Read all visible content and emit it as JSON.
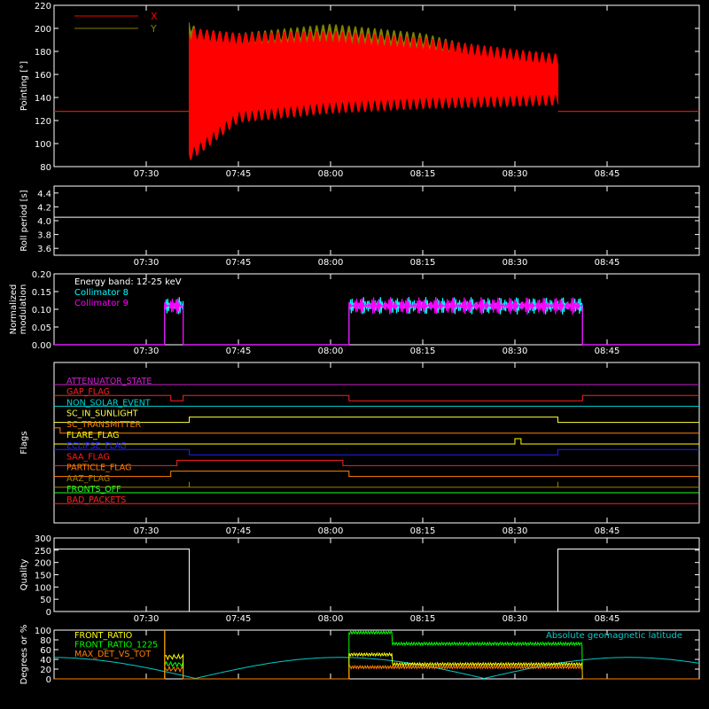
{
  "colors": {
    "background": "#000000",
    "axis": "#ffffff",
    "x_pointing": "#ff0000",
    "y_pointing": "#808000",
    "collimator8": "#00ffff",
    "collimator9": "#ff00ff",
    "geomag": "#00cccc",
    "front_ratio": "#ffff00",
    "front_ratio_1225": "#00ff00",
    "max_det": "#ff8000"
  },
  "time_axis": {
    "start": "07:15",
    "end": "09:00",
    "ticks": [
      "07:30",
      "07:45",
      "08:00",
      "08:15",
      "08:30",
      "08:45"
    ]
  },
  "chart_data": [
    {
      "id": "pointing",
      "type": "line",
      "ylabel": "Pointing [°]",
      "ylim": [
        80,
        220
      ],
      "yticks": [
        "80",
        "100",
        "120",
        "140",
        "160",
        "180",
        "200",
        "220"
      ],
      "legend": [
        "X",
        "Y"
      ],
      "series": [
        {
          "name": "X",
          "color": "#ff0000",
          "baseline": 128,
          "active": [
            "07:37",
            "08:37"
          ],
          "envelope": {
            "x": [
              "07:37",
              "07:38",
              "07:45",
              "08:00",
              "08:15",
              "08:30",
              "08:37"
            ],
            "low": [
              85,
              88,
              118,
              126,
              130,
              132,
              133
            ],
            "high": [
              200,
              200,
              196,
              198,
              192,
              182,
              178
            ]
          }
        },
        {
          "name": "Y",
          "color": "#808000",
          "baseline": 128,
          "active": [
            "07:37",
            "08:37"
          ],
          "envelope": {
            "x": [
              "07:37",
              "07:38",
              "07:45",
              "08:00",
              "08:15",
              "08:30",
              "08:37"
            ],
            "low": [
              100,
              105,
              122,
              132,
              136,
              136,
              136
            ],
            "high": [
              210,
              200,
              196,
              204,
              196,
              176,
              170
            ]
          }
        }
      ]
    },
    {
      "id": "roll",
      "type": "line",
      "ylabel": "Roll period [s]",
      "ylim": [
        3.5,
        4.5
      ],
      "yticks": [
        "3.6",
        "3.8",
        "4.0",
        "4.2",
        "4.4"
      ],
      "series": [
        {
          "values": [
            4.05,
            4.05
          ],
          "x": [
            "07:15",
            "09:00"
          ]
        }
      ]
    },
    {
      "id": "modulation",
      "type": "line",
      "ylabel": [
        "Normalized",
        "modulation"
      ],
      "ylim": [
        0,
        0.2
      ],
      "yticks": [
        "0.00",
        "0.05",
        "0.10",
        "0.15",
        "0.20"
      ],
      "annotation": "Energy band: 12-25 keV",
      "series": [
        {
          "name": "Collimator 8",
          "color": "#00ffff",
          "segments": [
            [
              "07:33",
              "07:36"
            ],
            [
              "08:03",
              "08:41"
            ]
          ],
          "mean": 0.11
        },
        {
          "name": "Collimator 9",
          "color": "#ff00ff",
          "segments": [
            [
              "07:33",
              "07:36"
            ],
            [
              "08:03",
              "08:41"
            ]
          ],
          "mean": 0.11
        }
      ]
    },
    {
      "id": "flags",
      "type": "line",
      "ylabel": "Flags",
      "series": [
        {
          "name": "ATTENUATOR_STATE",
          "color": "#d020d0",
          "steps": []
        },
        {
          "name": "GAP_FLAG",
          "color": "#ff2020",
          "steps": [
            [
              "07:15",
              1
            ],
            [
              "07:34",
              0
            ],
            [
              "07:36",
              1
            ],
            [
              "08:03",
              0
            ],
            [
              "08:41",
              1
            ]
          ]
        },
        {
          "name": "NON_SOLAR_EVENT",
          "color": "#00d0d0",
          "steps": []
        },
        {
          "name": "SC_IN_SUNLIGHT",
          "color": "#ffff40",
          "steps": [
            [
              "07:15",
              0
            ],
            [
              "07:37",
              1
            ],
            [
              "08:37",
              0
            ]
          ]
        },
        {
          "name": "SC_TRANSMITTER",
          "color": "#ff8000",
          "steps": [
            [
              "07:15",
              1
            ],
            [
              "07:16",
              0
            ]
          ]
        },
        {
          "name": "FLARE_FLAG",
          "color": "#ffff00",
          "steps": [
            [
              "07:15",
              0
            ],
            [
              "08:30",
              1
            ],
            [
              "08:31",
              0
            ]
          ]
        },
        {
          "name": "ECLIPSE_FLAG",
          "color": "#2020ff",
          "steps": [
            [
              "07:15",
              1
            ],
            [
              "07:37",
              0
            ],
            [
              "08:37",
              1
            ]
          ]
        },
        {
          "name": "SAA_FLAG",
          "color": "#ff2020",
          "steps": [
            [
              "07:15",
              0
            ],
            [
              "07:35",
              1
            ],
            [
              "08:02",
              0
            ]
          ]
        },
        {
          "name": "PARTICLE_FLAG",
          "color": "#ff8000",
          "steps": [
            [
              "07:15",
              0
            ],
            [
              "07:34",
              1
            ],
            [
              "08:03",
              0
            ]
          ]
        },
        {
          "name": "AAZ_FLAG",
          "color": "#a08000",
          "steps": [
            [
              "07:15",
              0
            ],
            [
              "07:37",
              1
            ],
            [
              "07:37",
              0
            ],
            [
              "08:37",
              1
            ],
            [
              "08:37",
              0
            ]
          ]
        },
        {
          "name": "FRONTS_OFF",
          "color": "#20ff20",
          "steps": []
        },
        {
          "name": "BAD_PACKETS",
          "color": "#ff2020",
          "steps": []
        }
      ]
    },
    {
      "id": "quality",
      "type": "line",
      "ylabel": "Quality",
      "ylim": [
        0,
        300
      ],
      "yticks": [
        "0",
        "50",
        "100",
        "150",
        "200",
        "250",
        "300"
      ],
      "series": [
        {
          "steps": [
            [
              "07:15",
              255
            ],
            [
              "07:37",
              0
            ],
            [
              "08:37",
              255
            ]
          ]
        }
      ]
    },
    {
      "id": "ratios",
      "type": "line",
      "ylabel": "Degrees or %",
      "ylim": [
        0,
        100
      ],
      "yticks": [
        "0",
        "20",
        "40",
        "60",
        "80",
        "100"
      ],
      "legend_right": "Absolute geomagnetic latitude",
      "series": [
        {
          "name": "FRONT_RATIO",
          "color": "#ffff00"
        },
        {
          "name": "FRONT_RATIO_1225",
          "color": "#00ff00"
        },
        {
          "name": "MAX_DET_VS_TOT",
          "color": "#ff8000"
        }
      ]
    }
  ]
}
